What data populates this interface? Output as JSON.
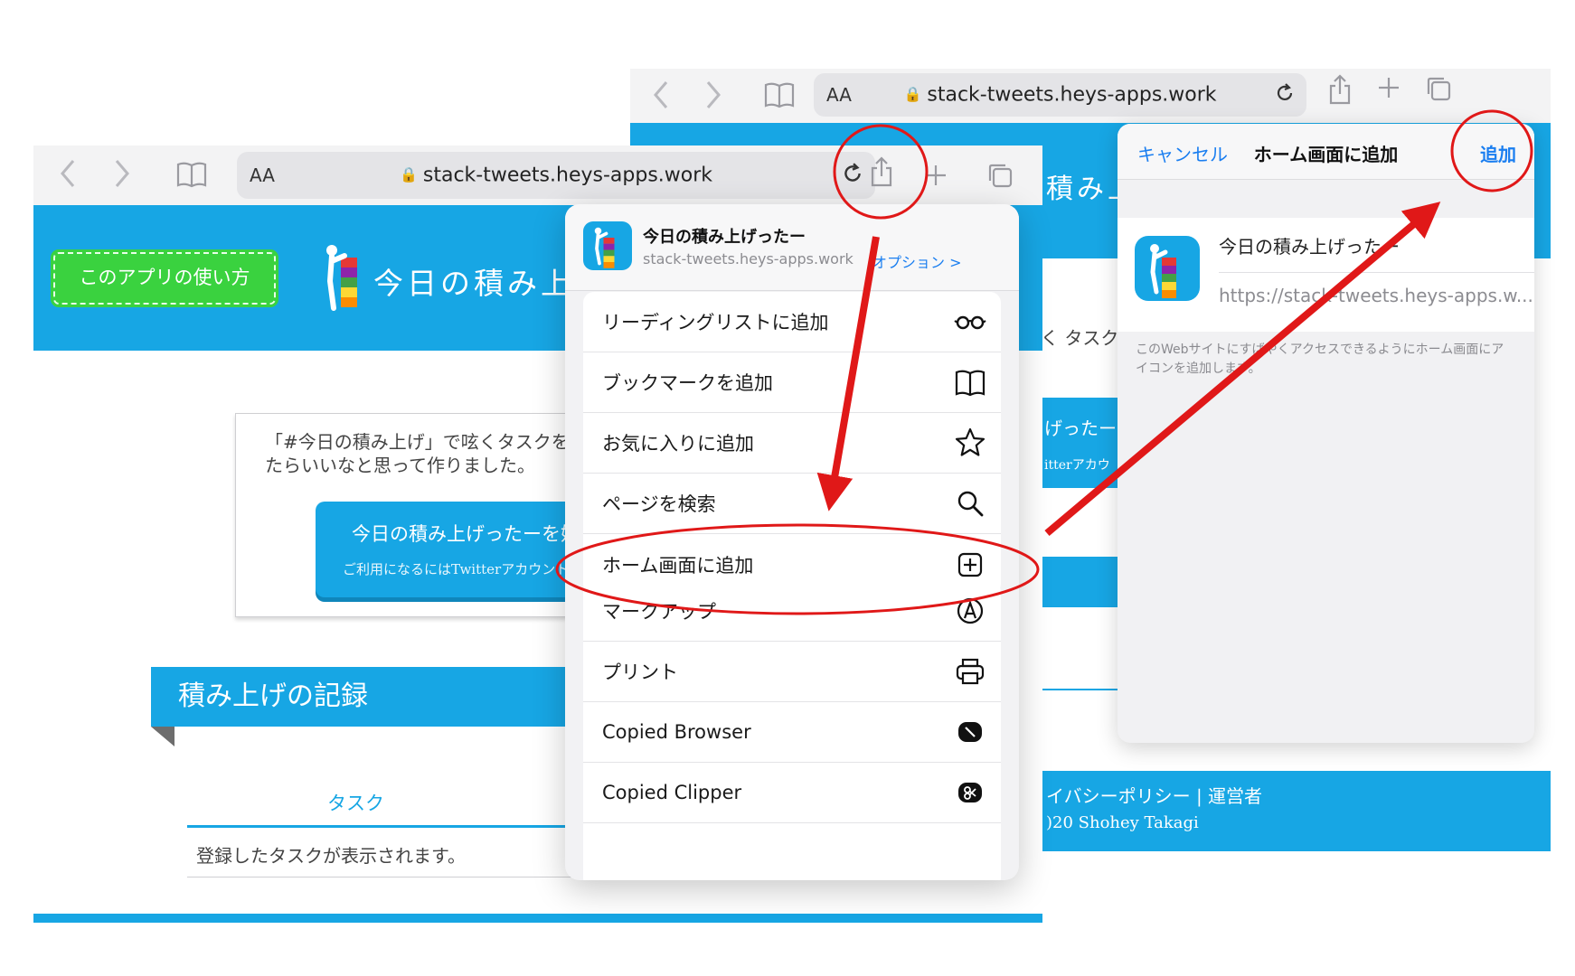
{
  "back_window": {
    "url": "stack-tweets.heys-apps.work",
    "aa_label": "AA",
    "behind_text": {
      "title_fragment": "積み上",
      "intro_fragment": "く タスク",
      "cta_fragment": "げったー",
      "cta_sub_fragment": "itterアカウ",
      "footer_links": "イバシーポリシー | 運営者",
      "footer_copy": ")20 Shohey Takagi"
    },
    "add_to_home": {
      "cancel": "キャンセル",
      "title": "ホーム画面に追加",
      "add": "追加",
      "app_name": "今日の積み上げったー",
      "app_url": "https://stack-tweets.heys-apps.w...",
      "note": "このWebサイトにすばやくアクセスできるようにホーム画面にアイコンを追加します。"
    }
  },
  "front_window": {
    "url": "stack-tweets.heys-apps.work",
    "aa_label": "AA",
    "page": {
      "howto_button": "このアプリの使い方",
      "site_title": "今日の積み上げったー",
      "intro_text": "「#今日の積み上げ」で呟くタスクを記録していけたらいいなと思って作りました。",
      "cta_title": "今日の積み上げったーを始める",
      "cta_sub": "ご利用になるにはTwitterアカウントが必要です",
      "section_title": "積み上げの記録",
      "table_header": "タスク",
      "empty_message": "登録したタスクが表示されます。"
    },
    "share_sheet": {
      "title": "今日の積み上げったー",
      "subtitle": "stack-tweets.heys-apps.work",
      "options_link": "オプション >",
      "group1": [
        {
          "label": "リーディングリストに追加",
          "icon": "glasses-icon"
        },
        {
          "label": "ブックマークを追加",
          "icon": "book-icon"
        },
        {
          "label": "お気に入りに追加",
          "icon": "star-icon"
        },
        {
          "label": "ページを検索",
          "icon": "search-icon"
        },
        {
          "label": "ホーム画面に追加",
          "icon": "add-square-icon"
        }
      ],
      "group2": [
        {
          "label": "マークアップ",
          "icon": "markup-icon"
        },
        {
          "label": "プリント",
          "icon": "printer-icon"
        },
        {
          "label": "Copied Browser",
          "icon": "copied-browser-icon"
        },
        {
          "label": "Copied Clipper",
          "icon": "copied-clipper-icon"
        }
      ]
    }
  },
  "colors": {
    "brand_blue": "#17a6e4",
    "link_blue": "#1a7ef0",
    "annotation_red": "#e01818",
    "howto_green": "#3ad23f"
  }
}
